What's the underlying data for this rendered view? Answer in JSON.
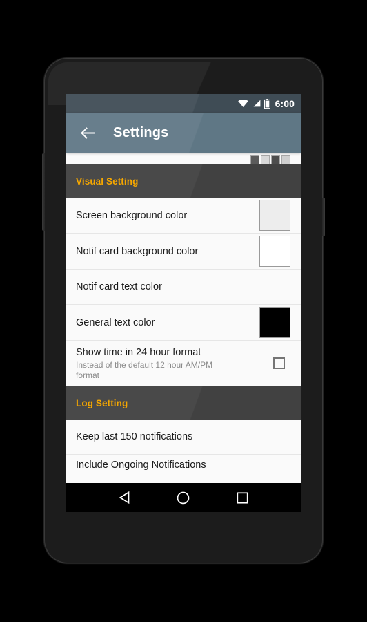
{
  "status_bar": {
    "time": "6:00",
    "battery_level_label": "100",
    "icons": [
      "wifi-icon",
      "cell-signal-icon",
      "battery-icon"
    ]
  },
  "toolbar": {
    "back_icon": "arrow-left-icon",
    "title": "Settings"
  },
  "colors": {
    "status_bar_bg": "#3f4c55",
    "toolbar_bg": "#5f7785",
    "section_header_bg": "#414141",
    "section_header_text": "#f5a700",
    "list_bg": "#fafafa",
    "primary_text": "#1b1b1b",
    "secondary_text": "#8a8a8a",
    "nav_bar_bg": "#000000"
  },
  "list": {
    "clipped_top_row": {
      "palette_chips": [
        "#5b5b5b",
        "#d8d8d8",
        "#4d4d4d",
        "#cfcfcf"
      ]
    },
    "sections": [
      {
        "header": "Visual Setting",
        "rows": [
          {
            "title": "Screen background color",
            "summary": "",
            "widget": "color-swatch",
            "swatch_color": "#ededed"
          },
          {
            "title": "Notif card background color",
            "summary": "",
            "widget": "color-swatch",
            "swatch_color": "#ffffff"
          },
          {
            "title": "Notif card text color",
            "summary": "",
            "widget": "none",
            "swatch_color": ""
          },
          {
            "title": "General text color",
            "summary": "",
            "widget": "color-swatch",
            "swatch_color": "#000000"
          },
          {
            "title": "Show time in 24 hour format",
            "summary": "Instead of the default 12 hour AM/PM format",
            "widget": "checkbox",
            "checked": false
          }
        ]
      },
      {
        "header": "Log Setting",
        "rows": [
          {
            "title": "Keep last 150 notifications",
            "summary": "",
            "widget": "none"
          },
          {
            "title": "Include Ongoing Notifications",
            "summary": "",
            "widget": "none"
          }
        ]
      }
    ]
  },
  "nav_bar": {
    "back": "nav-back-icon",
    "home": "nav-home-icon",
    "recents": "nav-recents-icon"
  }
}
